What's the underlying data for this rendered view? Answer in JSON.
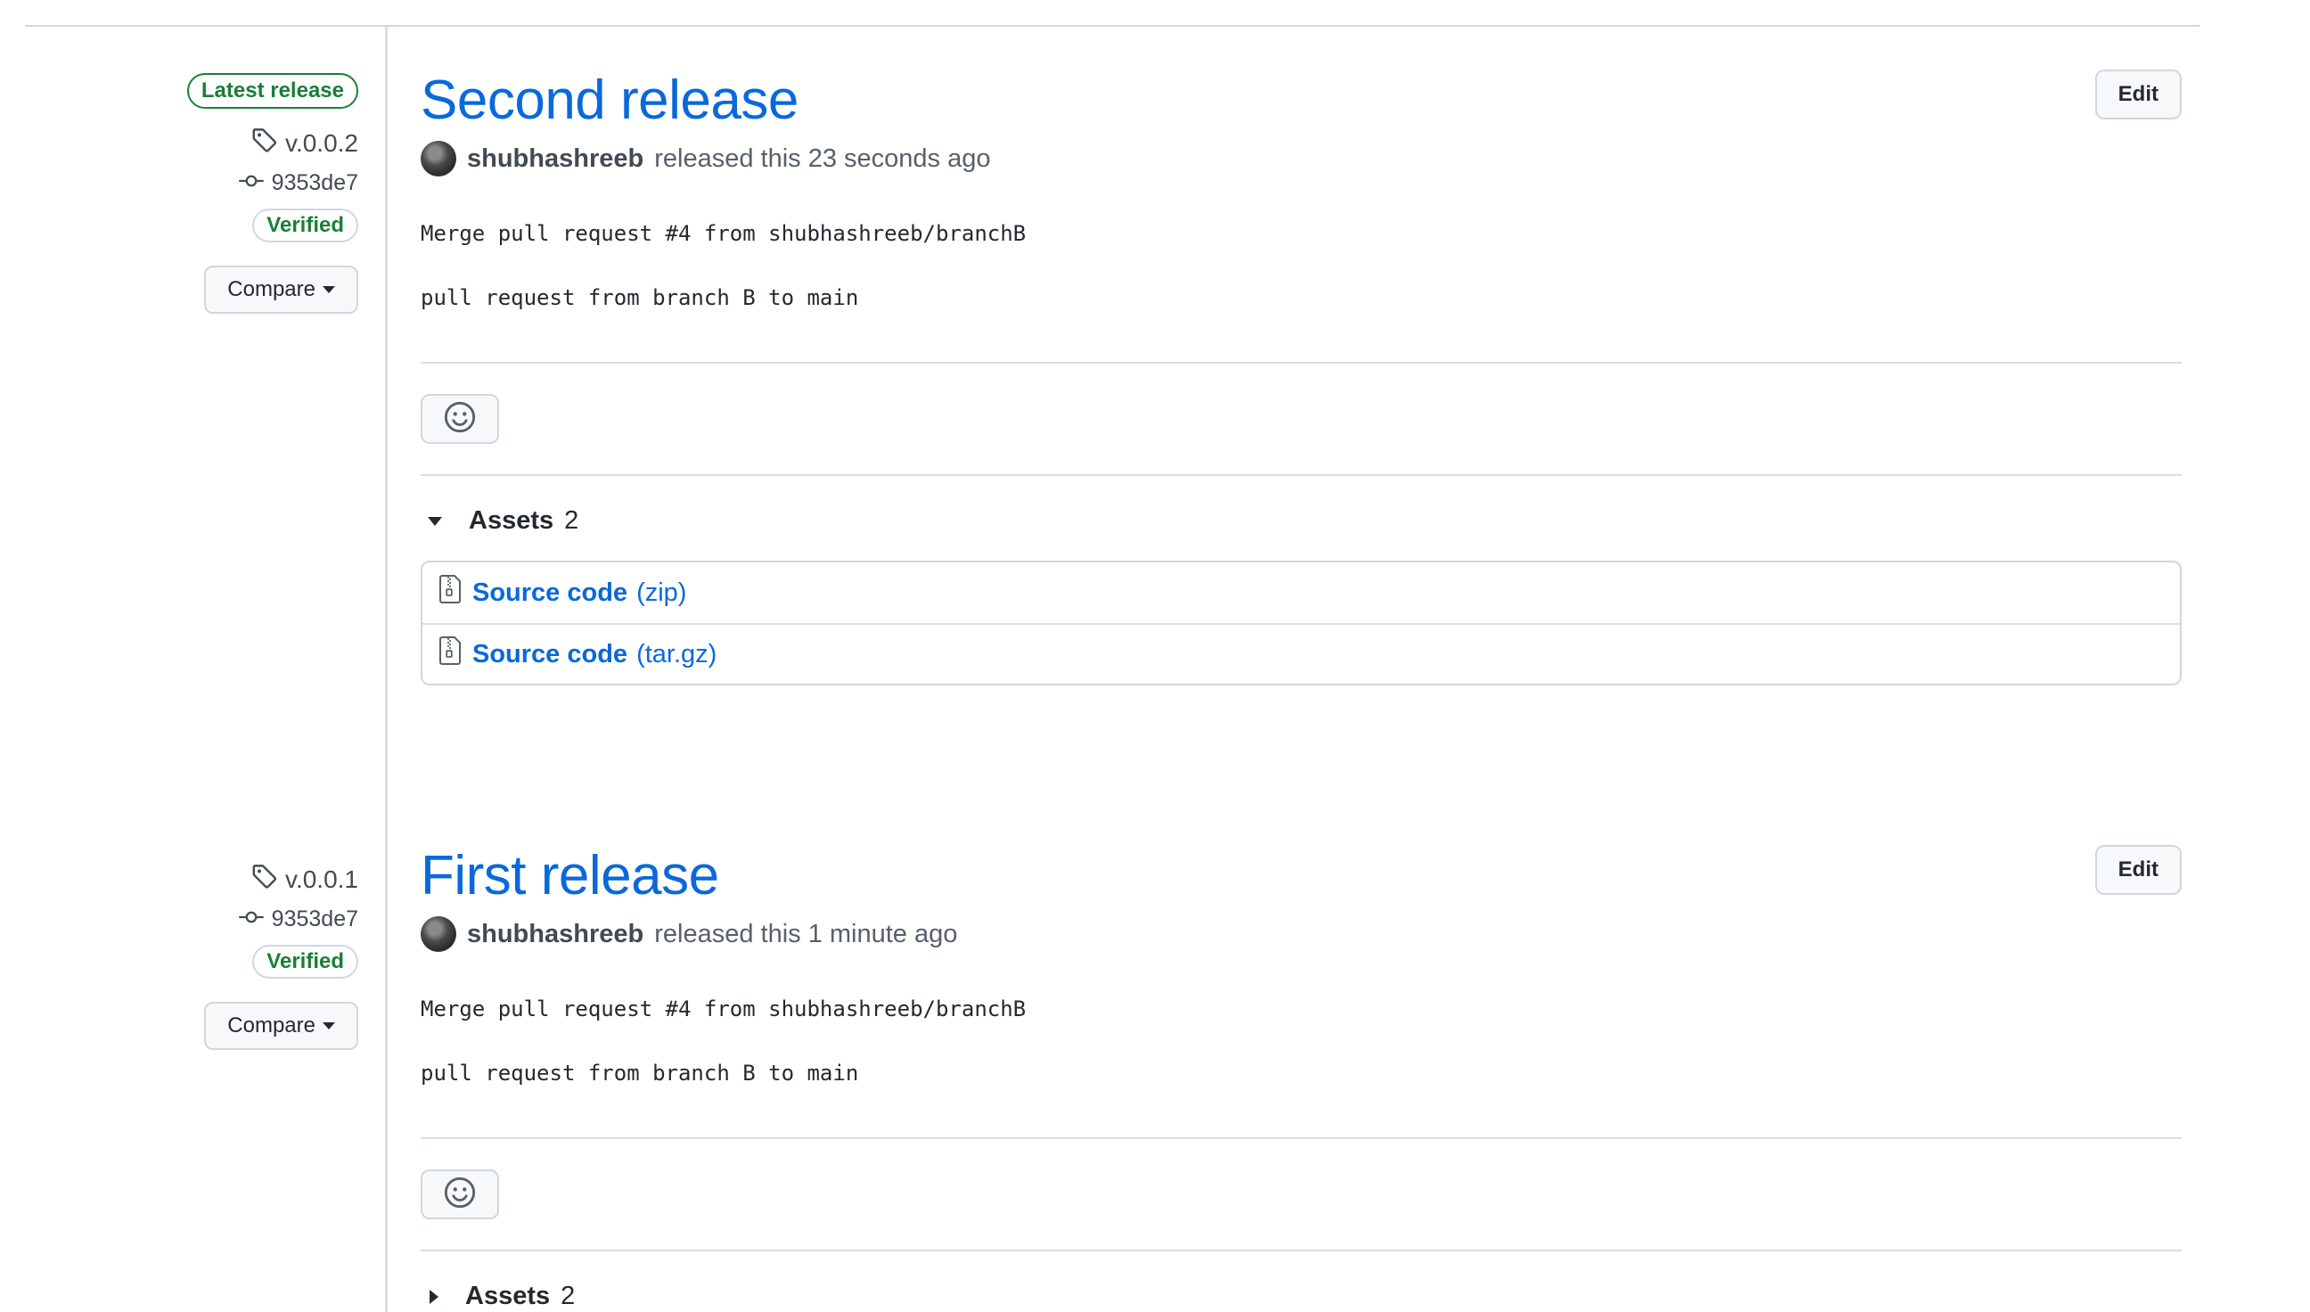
{
  "releases": [
    {
      "latest_badge": "Latest release",
      "tag": "v.0.0.2",
      "commit": "9353de7",
      "verified": "Verified",
      "compare_label": "Compare",
      "title": "Second release",
      "edit_label": "Edit",
      "author": "shubhashreeb",
      "released_text": "released this 23 seconds ago",
      "body_line1": "Merge pull request #4 from shubhashreeb/branchB",
      "body_line2": "pull request from branch B to main",
      "assets_label": "Assets",
      "assets_count": "2",
      "assets": [
        {
          "name": "Source code",
          "ext": "(zip)"
        },
        {
          "name": "Source code",
          "ext": "(tar.gz)"
        }
      ]
    },
    {
      "tag": "v.0.0.1",
      "commit": "9353de7",
      "verified": "Verified",
      "compare_label": "Compare",
      "title": "First release",
      "edit_label": "Edit",
      "author": "shubhashreeb",
      "released_text": "released this 1 minute ago",
      "body_line1": "Merge pull request #4 from shubhashreeb/branchB",
      "body_line2": "pull request from branch B to main",
      "assets_label": "Assets",
      "assets_count": "2"
    }
  ],
  "icons": {
    "tag": "tag-icon",
    "commit": "git-commit-icon",
    "caret": "triangle-down-icon",
    "smiley": "smiley-icon",
    "zip": "file-zip-icon"
  },
  "colors": {
    "link": "#0969da",
    "verified": "#1a7f37",
    "border": "#d0d7de"
  }
}
